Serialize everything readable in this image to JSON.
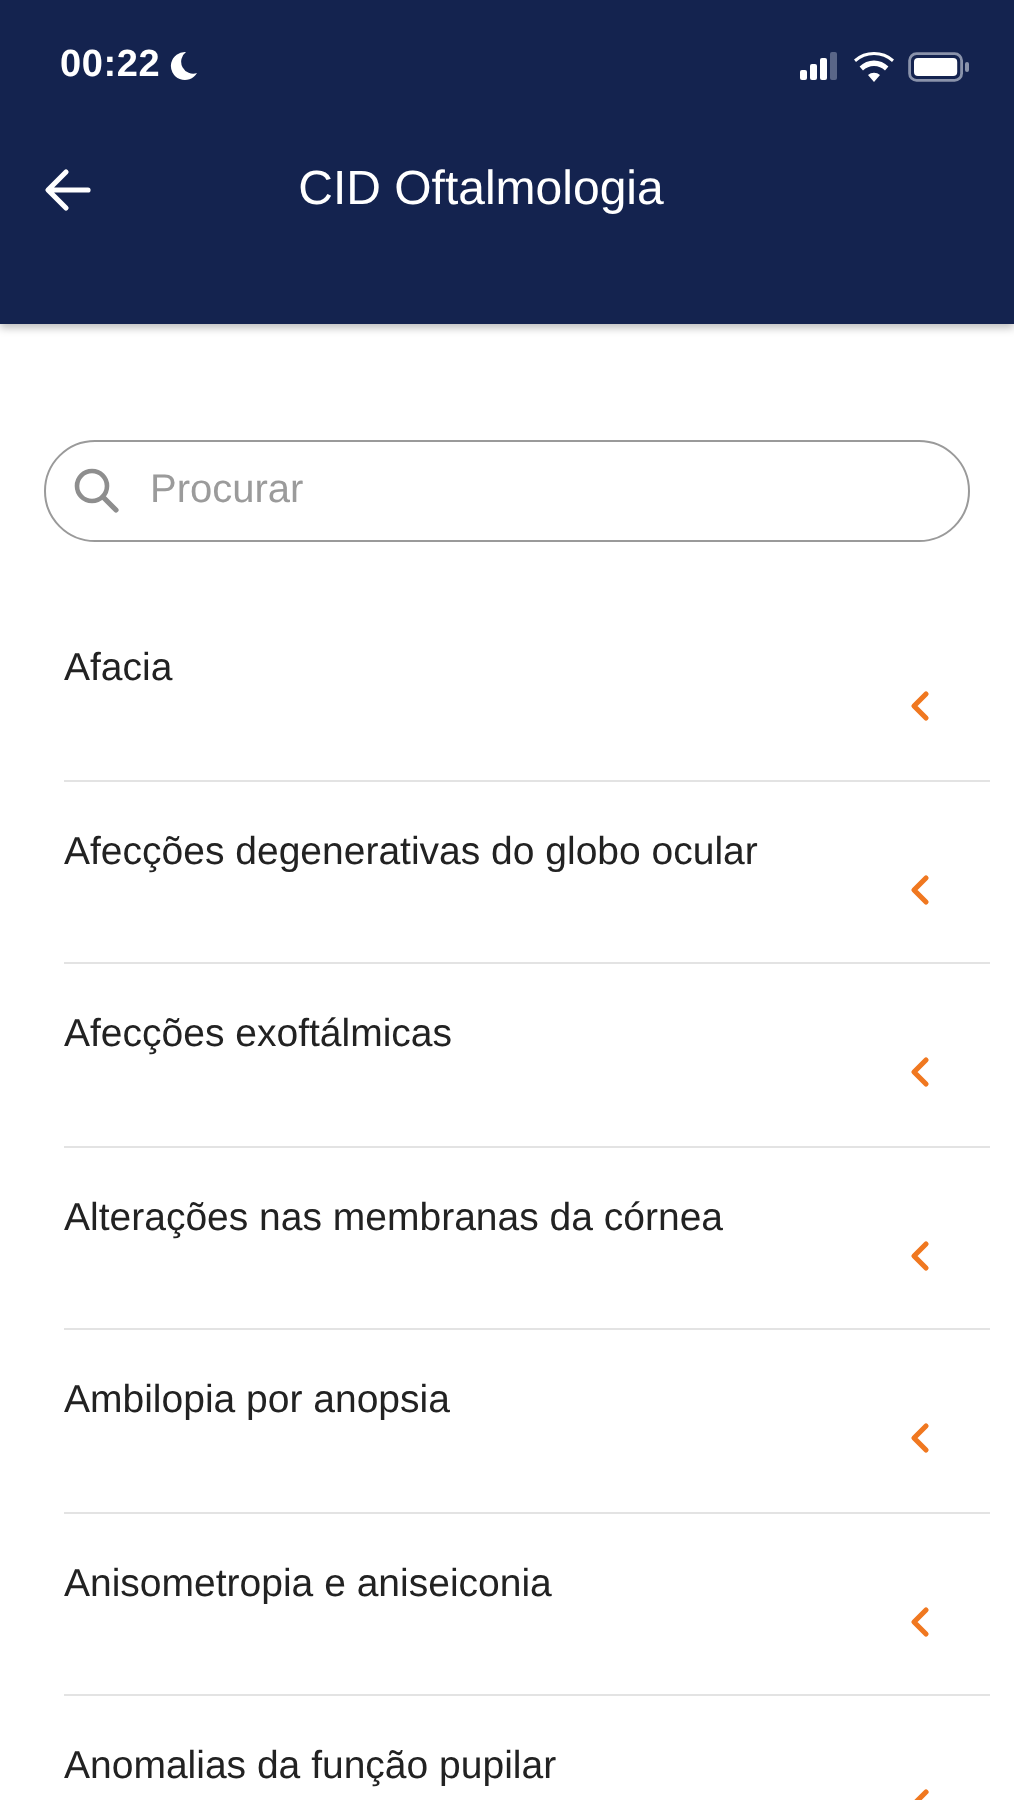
{
  "status_bar": {
    "time": "00:22"
  },
  "header": {
    "title": "CID Oftalmologia"
  },
  "search": {
    "placeholder": "Procurar"
  },
  "items": [
    {
      "label": "Afacia"
    },
    {
      "label": "Afecções degenerativas do globo ocular"
    },
    {
      "label": "Afecções exoftálmicas"
    },
    {
      "label": "Alterações nas membranas da córnea"
    },
    {
      "label": "Ambilopia por anopsia"
    },
    {
      "label": "Anisometropia e aniseiconia"
    },
    {
      "label": "Anomalias da função pupilar"
    }
  ]
}
